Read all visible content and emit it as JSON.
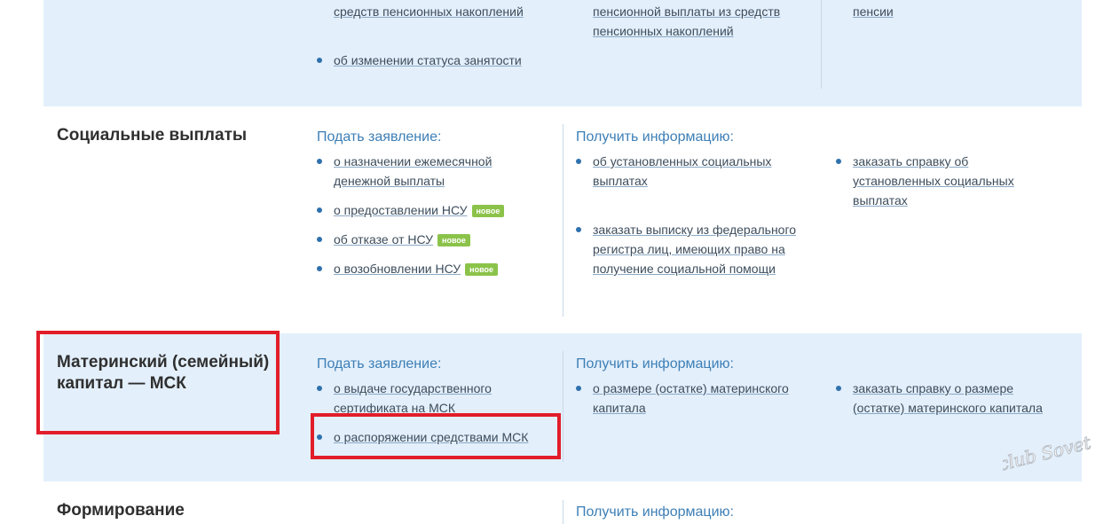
{
  "top_section": {
    "col1": [
      "средств пенсионных накоплений",
      "об изменении статуса занятости"
    ],
    "col2": "пенсионной выплаты из средств пенсионных накоплений",
    "col3": "пенсии"
  },
  "social": {
    "title": "Социальные выплаты",
    "apply_heading": "Подать заявление:",
    "info_heading": "Получить информацию:",
    "apply_items": [
      {
        "label": "о назначении ежемесячной денежной выплаты",
        "badge": ""
      },
      {
        "label": "о предоставлении НСУ",
        "badge": "новое"
      },
      {
        "label": "об отказе от НСУ",
        "badge": "новое"
      },
      {
        "label": "о возобновлении НСУ",
        "badge": "новое"
      }
    ],
    "info_items": [
      "об установленных социальных выплатах",
      "заказать выписку из федерального регистра лиц, имеющих право на получение социальной помощи"
    ],
    "info_items_col3": [
      "заказать справку об установленных социальных выплатах"
    ]
  },
  "maternity": {
    "title": "Материнский (семейный) капитал — МСК",
    "apply_heading": "Подать заявление:",
    "info_heading": "Получить информацию:",
    "apply_items": [
      "о выдаче государственного сертификата на МСК",
      "о распоряжении средствами МСК"
    ],
    "info_items": [
      "о размере (остатке) материнского капитала"
    ],
    "info_items_col3": [
      "заказать справку о размере (остатке) материнского капитала"
    ]
  },
  "formation": {
    "title": "Формирование",
    "info_heading": "Получить информацию:"
  },
  "watermark": {
    "text": "club Sovet"
  },
  "colors": {
    "band": "#e3effb",
    "link": "#3d4d5c",
    "heading": "#3d7fb6",
    "bullet": "#2f71ad",
    "badge": "#8bc34a",
    "highlight": "#e21d2a"
  }
}
